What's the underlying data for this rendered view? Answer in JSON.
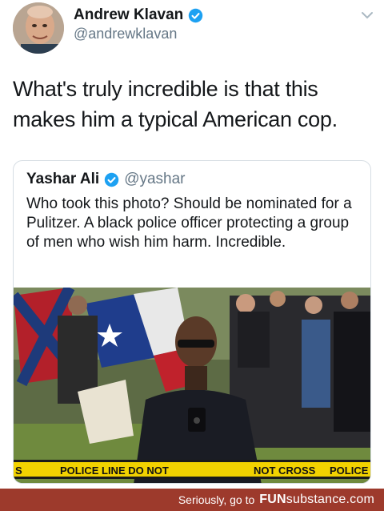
{
  "tweet": {
    "author_name": "Andrew Klavan",
    "author_handle": "@andrewklavan",
    "text": "What's truly incredible is that this makes him a typical American cop.",
    "verified_icon": "verified-badge-icon",
    "menu_icon": "chevron-down-icon"
  },
  "quoted_tweet": {
    "author_name": "Yashar Ali",
    "author_handle": "@yashar",
    "text": "Who took this photo? Should be nominated for a Pulitzer. A black police officer protecting a group of men who wish him harm. Incredible.",
    "tape_texts": [
      "S",
      "POLICE LINE DO NOT",
      "NOT CROSS",
      "POLICE LINE"
    ]
  },
  "footer": {
    "message": "Seriously, go to",
    "brand_bold": "FUN",
    "brand_rest": "substance.com"
  },
  "colors": {
    "verified_blue": "#1da1f2",
    "footer_bg": "#9d3a2c",
    "handle_gray": "#657786"
  }
}
